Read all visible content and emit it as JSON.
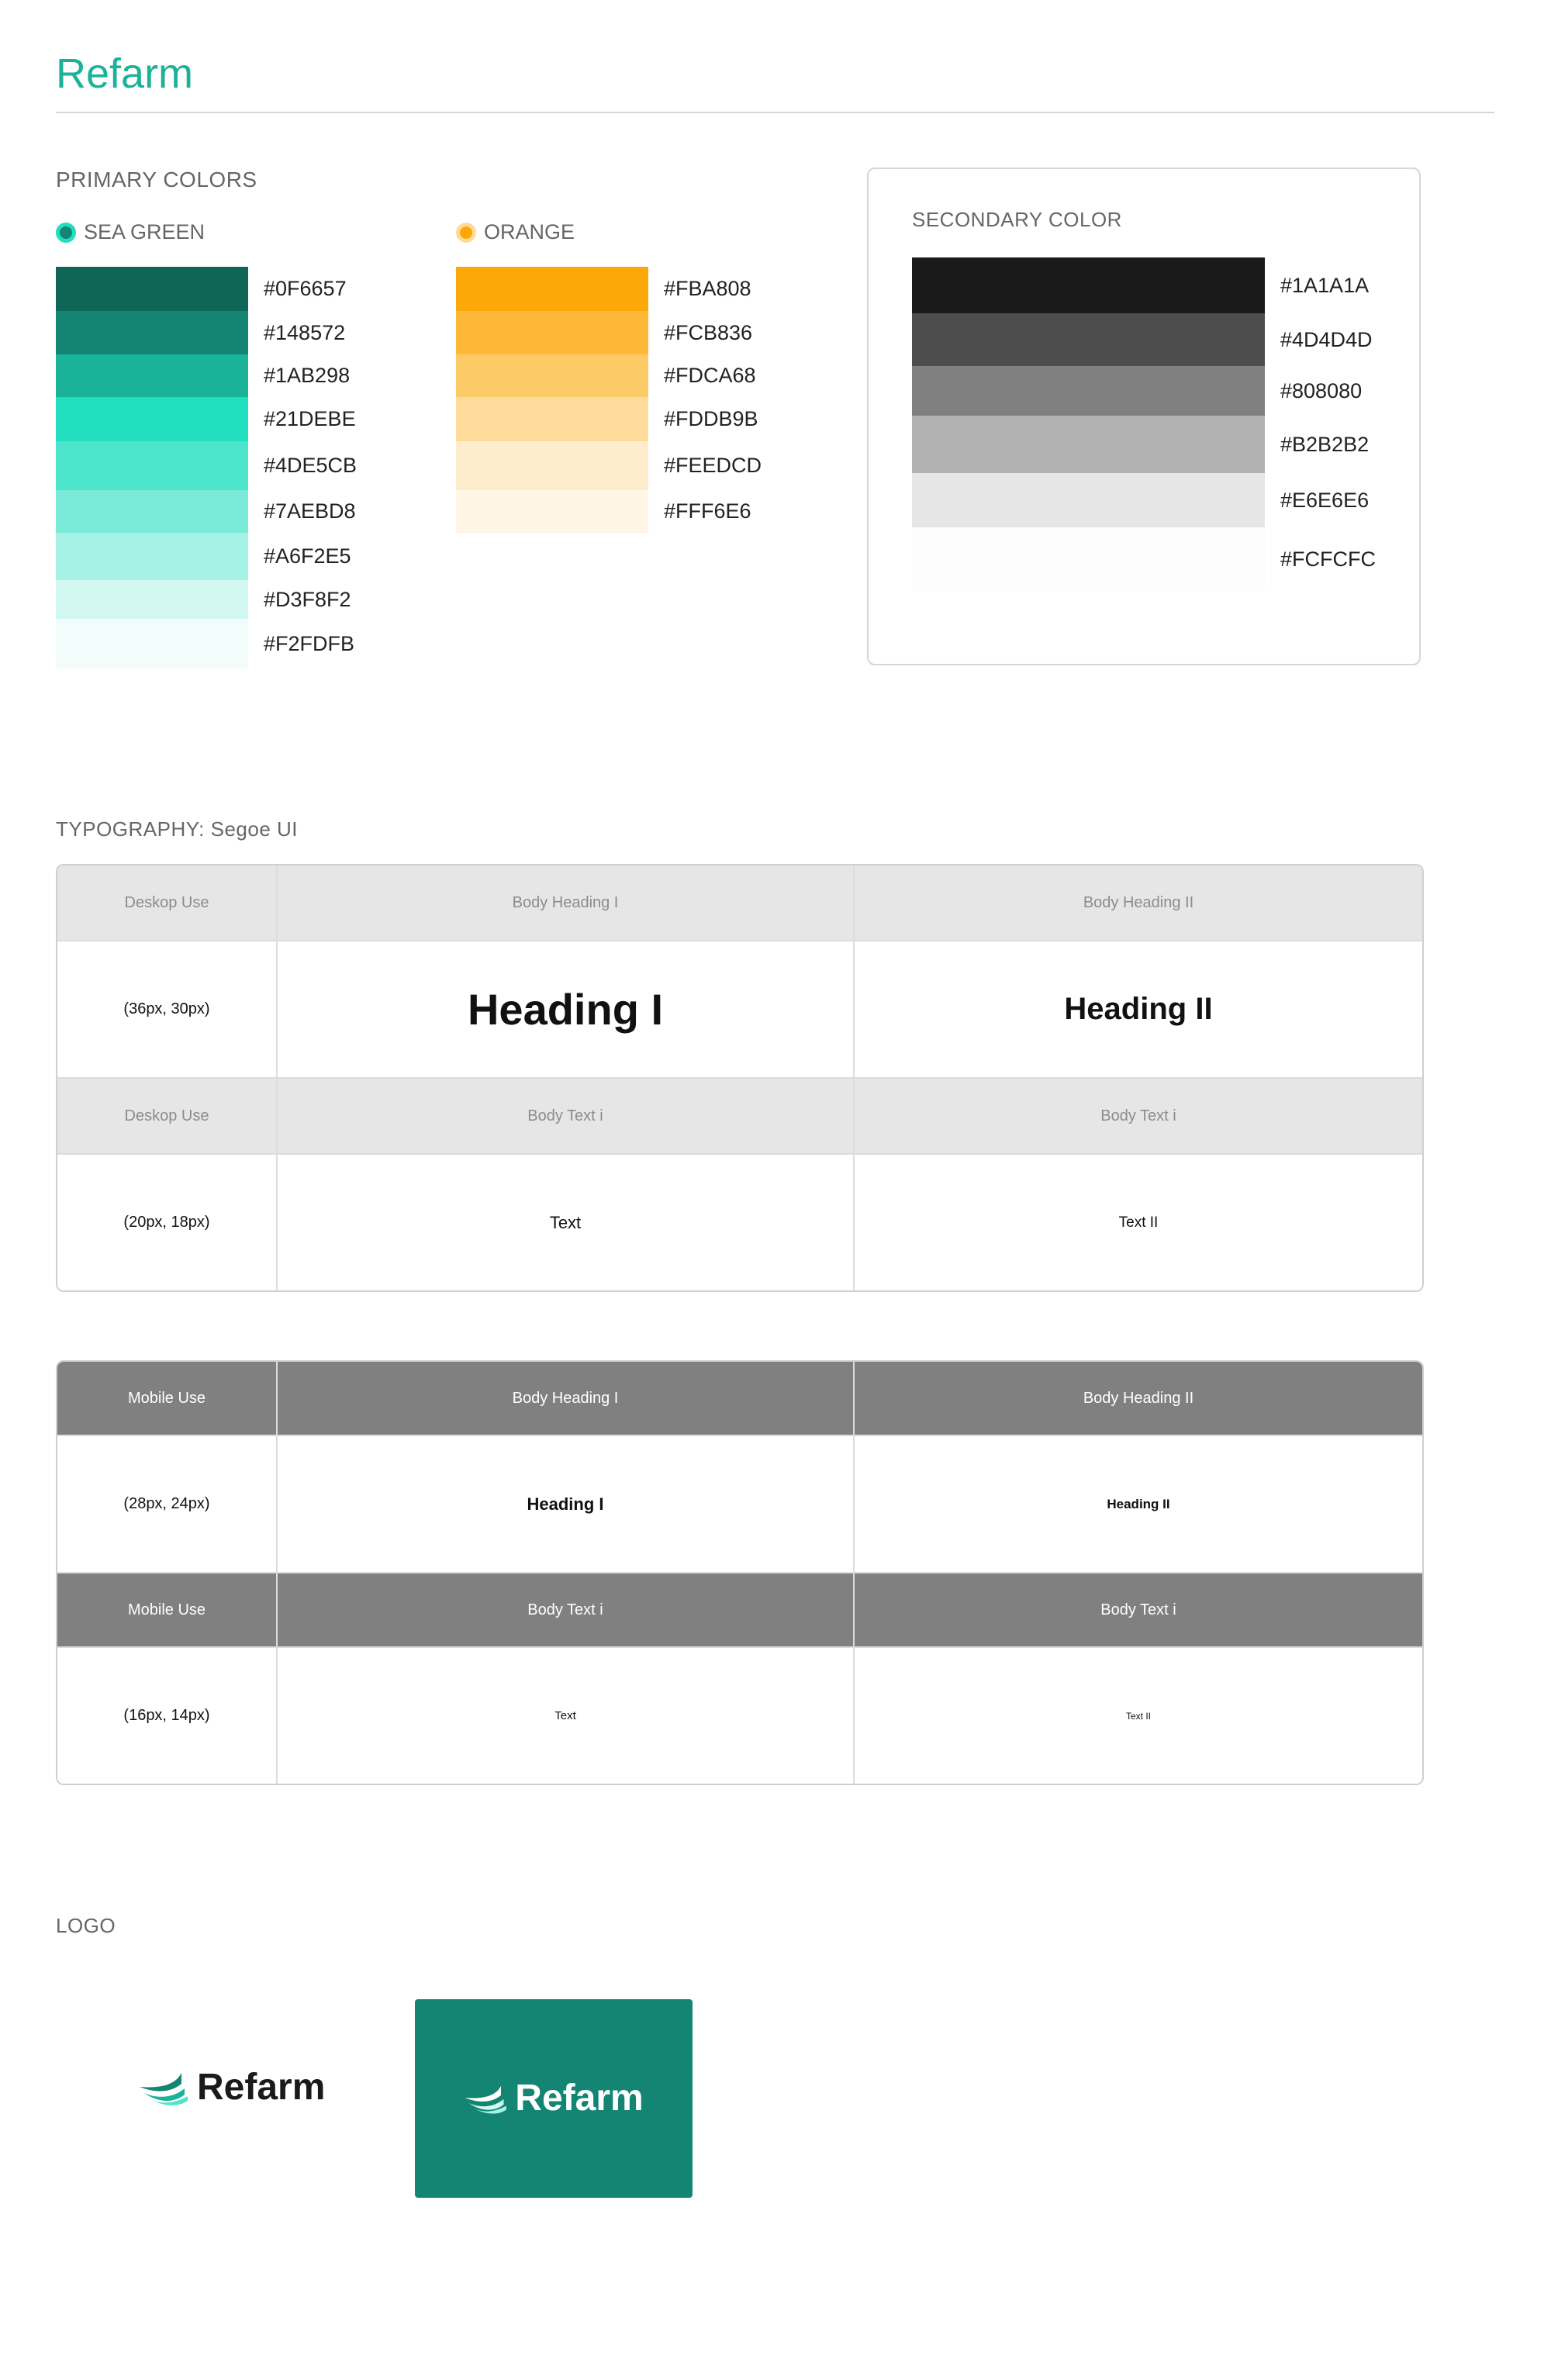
{
  "header": {
    "title": "Refarm"
  },
  "primary": {
    "label": "PRIMARY COLORS",
    "groups": [
      {
        "name": "SEA GREEN",
        "dot_fill": "#148572",
        "dot_ring": "#21DEBE",
        "swatches": [
          {
            "hex": "#0F6657",
            "label": "#0F6657"
          },
          {
            "hex": "#148572",
            "label": "#148572"
          },
          {
            "hex": "#1AB298",
            "label": "#1AB298"
          },
          {
            "hex": "#21DEBE",
            "label": "#21DEBE"
          },
          {
            "hex": "#4DE5CB",
            "label": "#4DE5CB"
          },
          {
            "hex": "#7AEBD8",
            "label": "#7AEBD8"
          },
          {
            "hex": "#A6F2E5",
            "label": "#A6F2E5"
          },
          {
            "hex": "#D3F8F2",
            "label": "#D3F8F2"
          },
          {
            "hex": "#F2FDFB",
            "label": "#F2FDFB"
          }
        ]
      },
      {
        "name": "ORANGE",
        "dot_fill": "#FBA808",
        "dot_ring": "#FDDB9B",
        "swatches": [
          {
            "hex": "#FBA808",
            "label": "#FBA808"
          },
          {
            "hex": "#FCB836",
            "label": "#FCB836"
          },
          {
            "hex": "#FDCA68",
            "label": "#FDCA68"
          },
          {
            "hex": "#FDDB9B",
            "label": "#FDDB9B"
          },
          {
            "hex": "#FEEDCD",
            "label": "#FEEDCD"
          },
          {
            "hex": "#FFF6E6",
            "label": "#FFF6E6"
          }
        ]
      }
    ]
  },
  "secondary": {
    "label": "SECONDARY COLOR",
    "swatches": [
      {
        "hex": "#1A1A1A",
        "label": "#1A1A1A"
      },
      {
        "hex": "#4D4D4D",
        "label": "#4D4D4D"
      },
      {
        "hex": "#808080",
        "label": "#808080"
      },
      {
        "hex": "#B2B2B2",
        "label": "#B2B2B2"
      },
      {
        "hex": "#E6E6E6",
        "label": "#E6E6E6"
      },
      {
        "hex": "#FCFCFC",
        "label": "#FCFCFC"
      }
    ]
  },
  "typography": {
    "label": "TYPOGRAPHY: Segoe UI",
    "desktop": {
      "heading_header": [
        "Deskop Use",
        "Body Heading I",
        "Body Heading II"
      ],
      "heading_row": [
        "(36px, 30px)",
        "Heading I",
        "Heading II"
      ],
      "text_header": [
        "Deskop Use",
        "Body Text i",
        "Body Text i"
      ],
      "text_row": [
        "(20px, 18px)",
        "Text",
        "Text II"
      ]
    },
    "mobile": {
      "heading_header": [
        "Mobile Use",
        "Body Heading I",
        "Body Heading II"
      ],
      "heading_row": [
        "(28px, 24px)",
        "Heading I",
        "Heading II"
      ],
      "text_header": [
        "Mobile Use",
        "Body Text i",
        "Body Text i"
      ],
      "text_row": [
        "(16px, 14px)",
        "Text",
        "Text II"
      ]
    }
  },
  "logo": {
    "label": "LOGO",
    "wordmark": "Refarm",
    "dark_bg": "#148572",
    "icon": "leaf-icon"
  }
}
